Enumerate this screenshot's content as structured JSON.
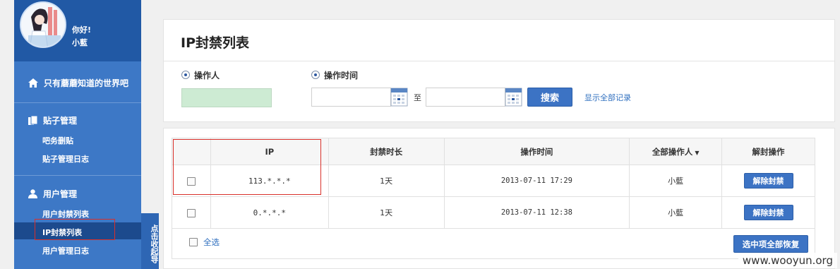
{
  "user": {
    "greeting": "你好!",
    "name": "小藍"
  },
  "sidebar": {
    "home_label": "只有蘑蘑知道的世界吧",
    "posts": {
      "title": "贴子管理",
      "items": [
        "吧务删贴",
        "贴子管理日志"
      ]
    },
    "users": {
      "title": "用户管理",
      "items": [
        "用户封禁列表",
        "IP封禁列表",
        "用户管理日志"
      ]
    },
    "collapse_label": "点击收起导"
  },
  "page": {
    "title": "IP封禁列表"
  },
  "filter": {
    "operator_label": "操作人",
    "time_label": "操作时间",
    "to_label": "至",
    "search_label": "搜索",
    "show_all_label": "显示全部记录"
  },
  "table": {
    "headers": {
      "ip": "IP",
      "duration": "封禁时长",
      "time": "操作时间",
      "operator": "全部操作人",
      "action": "解封操作"
    },
    "rows": [
      {
        "ip": "113.*.*.*",
        "duration": "1天",
        "time": "2013-07-11 17:29",
        "operator": "小藍",
        "action": "解除封禁"
      },
      {
        "ip": "0.*.*.*",
        "duration": "1天",
        "time": "2013-07-11 12:38",
        "operator": "小藍",
        "action": "解除封禁"
      }
    ],
    "select_all_label": "全选",
    "restore_label": "选中项全部恢复"
  },
  "watermark": "www.wooyun.org",
  "colors": {
    "sidebar": "#3d78c6",
    "sidebar_top": "#2159a5",
    "button": "#3c73c4",
    "link": "#2f6fbf",
    "annotation": "#d9302a"
  }
}
